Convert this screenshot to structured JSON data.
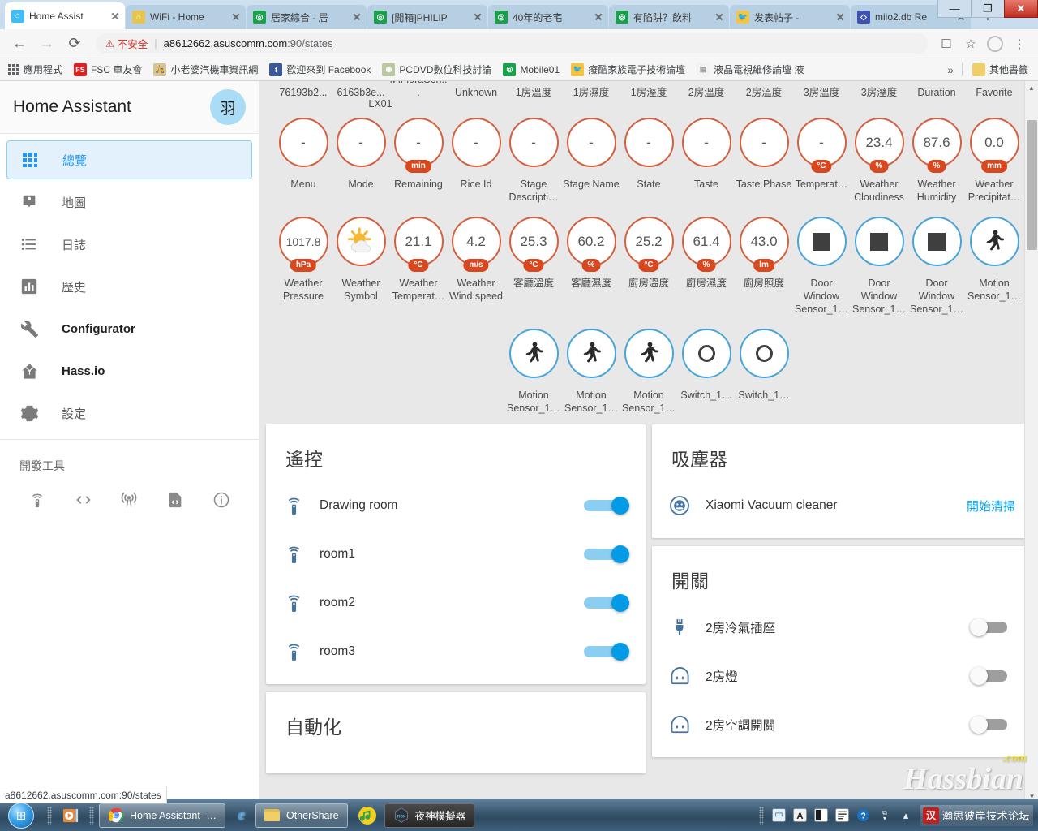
{
  "browser": {
    "tabs": [
      {
        "label": "Home Assist",
        "favicon": "ha-icon",
        "active": true
      },
      {
        "label": "WiFi - Home",
        "favicon": "ha-alt-icon",
        "active": false
      },
      {
        "label": "居家綜合 - 居",
        "favicon": "forum-icon",
        "active": false
      },
      {
        "label": "[開箱]PHILIP",
        "favicon": "forum-icon",
        "active": false
      },
      {
        "label": "40年的老宅",
        "favicon": "forum-icon",
        "active": false
      },
      {
        "label": "有陷阱？飲料",
        "favicon": "forum-icon",
        "active": false
      },
      {
        "label": "发表帖子 - ",
        "favicon": "bird-icon",
        "active": false
      },
      {
        "label": "miio2.db Re",
        "favicon": "code-icon",
        "active": false
      }
    ],
    "new_tab_label": "+",
    "window_controls": {
      "minimize": "—",
      "maximize": "❐",
      "close": "✕"
    },
    "nav": {
      "back": "←",
      "forward": "→",
      "reload": "⟳"
    },
    "address": {
      "security_warning": "不安全",
      "warning_icon": "warning-triangle-icon",
      "url_host": "a8612662.asuscomm.com",
      "url_port": ":90",
      "url_path": "/states"
    },
    "toolbar_icons": [
      "translate-icon",
      "star-icon",
      "profile-icon",
      "menu-dots-icon"
    ],
    "bookmarks": [
      {
        "label": "應用程式",
        "icon": "apps-grid-icon"
      },
      {
        "label": "FSC 車友會",
        "icon": "fsc-icon"
      },
      {
        "label": "小老婆汽機車資訊網",
        "icon": "site-icon"
      },
      {
        "label": "歡迎來到 Facebook",
        "icon": "facebook-icon"
      },
      {
        "label": "PCDVD數位科技討論",
        "icon": "pcdvd-icon"
      },
      {
        "label": "Mobile01",
        "icon": "forum-icon"
      },
      {
        "label": "癈酷家族電子技術論壇",
        "icon": "bird-icon"
      },
      {
        "label": "液晶電視維修論壇 液",
        "icon": "page-icon"
      }
    ],
    "bookmarks_overflow": "»",
    "other_bookmarks": {
      "label": "其他書籤",
      "icon": "folder-icon"
    }
  },
  "sidebar": {
    "title": "Home Assistant",
    "avatar_initial": "羽",
    "items": [
      {
        "label": "總覽",
        "icon": "apps-grid-icon",
        "active": true,
        "bold": false
      },
      {
        "label": "地圖",
        "icon": "account-badge-icon",
        "active": false,
        "bold": false
      },
      {
        "label": "日誌",
        "icon": "format-list-icon",
        "active": false,
        "bold": false
      },
      {
        "label": "歷史",
        "icon": "chart-box-icon",
        "active": false,
        "bold": false
      },
      {
        "label": "Configurator",
        "icon": "wrench-icon",
        "active": false,
        "bold": true
      },
      {
        "label": "Hass.io",
        "icon": "home-assistant-icon",
        "active": false,
        "bold": true
      },
      {
        "label": "設定",
        "icon": "gear-icon",
        "active": false,
        "bold": false
      }
    ],
    "dev_tools_title": "開發工具",
    "dev_tools_icons": [
      "remote-icon",
      "code-tags-icon",
      "broadcast-icon",
      "file-code-icon",
      "information-icon"
    ]
  },
  "main": {
    "badge_row_clipped": [
      "76193b2...",
      "6163b3e...",
      "MiFloraSen...",
      "Unknown",
      "1房溫度",
      "1房濕度",
      "1房溼度",
      "2房溫度",
      "2房溫度",
      "3房溫度",
      "3房溼度",
      "Duration",
      "Favorite"
    ],
    "badge_row_clipped_second_line": "LX01",
    "badge_rows": [
      [
        {
          "value": "-",
          "unit": null,
          "label": "Menu",
          "color": "orange",
          "icon": null
        },
        {
          "value": "-",
          "unit": null,
          "label": "Mode",
          "color": "orange",
          "icon": null
        },
        {
          "value": "-",
          "unit": "min",
          "label": "Remaining",
          "color": "orange",
          "icon": null
        },
        {
          "value": "-",
          "unit": null,
          "label": "Rice Id",
          "color": "orange",
          "icon": null
        },
        {
          "value": "-",
          "unit": null,
          "label": "Stage Descripti…",
          "color": "orange",
          "icon": null
        },
        {
          "value": "-",
          "unit": null,
          "label": "Stage Name",
          "color": "orange",
          "icon": null
        },
        {
          "value": "-",
          "unit": null,
          "label": "State",
          "color": "orange",
          "icon": null
        },
        {
          "value": "-",
          "unit": null,
          "label": "Taste",
          "color": "orange",
          "icon": null
        },
        {
          "value": "-",
          "unit": null,
          "label": "Taste Phase",
          "color": "orange",
          "icon": null
        },
        {
          "value": "-",
          "unit": "°C",
          "label": "Temperat…",
          "color": "orange",
          "icon": null
        },
        {
          "value": "23.4",
          "unit": "%",
          "label": "Weather Cloudiness",
          "color": "orange",
          "icon": null
        },
        {
          "value": "87.6",
          "unit": "%",
          "label": "Weather Humidity",
          "color": "orange",
          "icon": null
        },
        {
          "value": "0.0",
          "unit": "mm",
          "label": "Weather Precipitat…",
          "color": "orange",
          "icon": null
        }
      ],
      [
        {
          "value": "1017.8",
          "unit": "hPa",
          "label": "Weather Pressure",
          "color": "orange",
          "icon": null
        },
        {
          "value": "",
          "unit": null,
          "label": "Weather Symbol",
          "color": "orange",
          "icon": "sun-cloud-icon"
        },
        {
          "value": "21.1",
          "unit": "°C",
          "label": "Weather Temperat…",
          "color": "orange",
          "icon": null
        },
        {
          "value": "4.2",
          "unit": "m/s",
          "label": "Weather Wind speed",
          "color": "orange",
          "icon": null
        },
        {
          "value": "25.3",
          "unit": "°C",
          "label": "客廳溫度",
          "color": "orange",
          "icon": null
        },
        {
          "value": "60.2",
          "unit": "%",
          "label": "客廳濕度",
          "color": "orange",
          "icon": null
        },
        {
          "value": "25.2",
          "unit": "°C",
          "label": "廚房溫度",
          "color": "orange",
          "icon": null
        },
        {
          "value": "61.4",
          "unit": "%",
          "label": "廚房濕度",
          "color": "orange",
          "icon": null
        },
        {
          "value": "43.0",
          "unit": "lm",
          "label": "廚房照度",
          "color": "orange",
          "icon": null
        },
        {
          "value": "",
          "unit": null,
          "label": "Door Window Sensor_1…",
          "color": "blue",
          "icon": "square-icon"
        },
        {
          "value": "",
          "unit": null,
          "label": "Door Window Sensor_1…",
          "color": "blue",
          "icon": "square-icon"
        },
        {
          "value": "",
          "unit": null,
          "label": "Door Window Sensor_1…",
          "color": "blue",
          "icon": "square-icon"
        },
        {
          "value": "",
          "unit": null,
          "label": "Motion Sensor_1…",
          "color": "blue",
          "icon": "walk-icon"
        }
      ],
      [
        {
          "value": "",
          "unit": null,
          "label": "Motion Sensor_1…",
          "color": "blue",
          "icon": "walk-icon"
        },
        {
          "value": "",
          "unit": null,
          "label": "Motion Sensor_1…",
          "color": "blue",
          "icon": "walk-icon"
        },
        {
          "value": "",
          "unit": null,
          "label": "Motion Sensor_1…",
          "color": "blue",
          "icon": "walk-icon"
        },
        {
          "value": "",
          "unit": null,
          "label": "Switch_1…",
          "color": "blue",
          "icon": "circle-outline-icon"
        },
        {
          "value": "",
          "unit": null,
          "label": "Switch_1…",
          "color": "blue",
          "icon": "circle-outline-icon"
        }
      ]
    ],
    "cards_left": [
      {
        "title": "遙控",
        "rows": [
          {
            "label": "Drawing room",
            "icon": "remote-icon",
            "toggle": "on"
          },
          {
            "label": "room1",
            "icon": "remote-icon",
            "toggle": "on"
          },
          {
            "label": "room2",
            "icon": "remote-icon",
            "toggle": "on"
          },
          {
            "label": "room3",
            "icon": "remote-icon",
            "toggle": "on"
          }
        ]
      },
      {
        "title": "自動化",
        "rows": []
      }
    ],
    "cards_right": [
      {
        "title": "吸塵器",
        "rows": [
          {
            "label": "Xiaomi Vacuum cleaner",
            "icon": "robot-vacuum-icon",
            "action": "開始清掃"
          }
        ]
      },
      {
        "title": "開關",
        "rows": [
          {
            "label": "2房冷氣插座",
            "icon": "power-plug-icon",
            "toggle": "off"
          },
          {
            "label": "2房燈",
            "icon": "power-socket-icon",
            "toggle": "off"
          },
          {
            "label": "2房空調開關",
            "icon": "power-socket-icon",
            "toggle": "off"
          }
        ]
      }
    ]
  },
  "status_bar": {
    "text": "a8612662.asuscomm.com:90/states"
  },
  "watermark": {
    "text": "Hassbian",
    "suffix": ".com"
  },
  "taskbar": {
    "start_label": "⊞",
    "buttons": [
      {
        "label": "Home Assistant -…",
        "icon": "chrome-icon"
      },
      {
        "label": "OtherShare",
        "icon": "folder-icon"
      }
    ],
    "quick_launch": [
      "media-player-icon"
    ],
    "nox_button": {
      "label": "夜神模擬器",
      "icon": "nox-icon"
    },
    "ie_icon": "internet-explorer-icon",
    "tray_icons": [
      "ime-icon",
      "ime-a-icon",
      "ime-half-icon",
      "ime-list-icon",
      "help-icon",
      "show-desktop-icon",
      "overflow-up-icon"
    ],
    "forum_widget": {
      "label": "瀚思彼岸技术论坛",
      "logo": "forum-logo-icon"
    }
  },
  "colors": {
    "accent_blue": "#03a9f4",
    "badge_orange": "#d8471e",
    "badge_blue": "#49a5d8",
    "sidebar_active_bg": "#e2f1fb",
    "icon_blue": "#44739e"
  }
}
